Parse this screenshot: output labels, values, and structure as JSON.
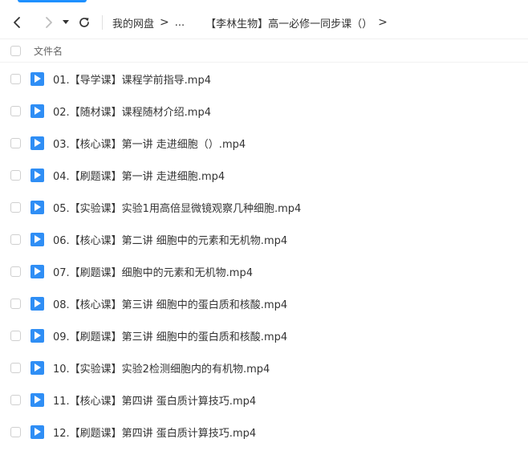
{
  "toolbar": {
    "icons": [
      "chevron-left-icon",
      "chevron-right-icon",
      "caret-down-icon",
      "refresh-icon"
    ],
    "breadcrumb": {
      "root": "我的网盘",
      "ellipsis": "...",
      "current": "【李林生物】高一必修一同步课（）",
      "separator": ">"
    }
  },
  "list_header": {
    "name_label": "文件名"
  },
  "files": [
    {
      "name": "01.【导学课】课程学前指导.mp4"
    },
    {
      "name": "02.【随材课】课程随材介绍.mp4"
    },
    {
      "name": "03.【核心课】第一讲 走进细胞（）.mp4"
    },
    {
      "name": "04.【刷题课】第一讲 走进细胞.mp4"
    },
    {
      "name": "05.【实验课】实验1用高倍显微镜观察几种细胞.mp4"
    },
    {
      "name": "06.【核心课】第二讲 细胞中的元素和无机物.mp4"
    },
    {
      "name": "07.【刷题课】细胞中的元素和无机物.mp4"
    },
    {
      "name": "08.【核心课】第三讲 细胞中的蛋白质和核酸.mp4"
    },
    {
      "name": "09.【刷题课】第三讲 细胞中的蛋白质和核酸.mp4"
    },
    {
      "name": "10.【实验课】实验2检测细胞内的有机物.mp4"
    },
    {
      "name": "11.【核心课】第四讲 蛋白质计算技巧.mp4"
    },
    {
      "name": "12.【刷题课】第四讲 蛋白质计算技巧.mp4"
    }
  ],
  "colors": {
    "accent": "#1e90ff",
    "file_icon": "#2f8ef5"
  }
}
